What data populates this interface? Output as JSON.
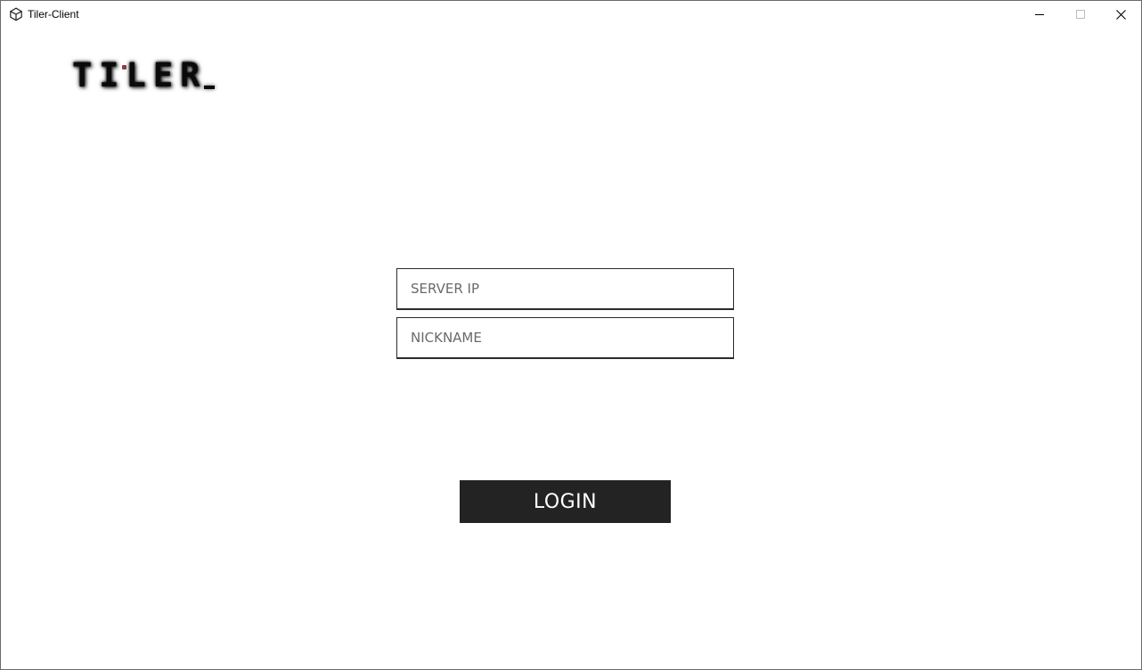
{
  "window": {
    "title": "Tiler-Client",
    "controls": {
      "minimize_icon": "minimize-icon",
      "maximize_icon": "maximize-icon",
      "close_icon": "close-icon"
    }
  },
  "logo": {
    "text": "TILER"
  },
  "form": {
    "server_ip": {
      "value": "",
      "placeholder": "SERVER IP"
    },
    "nickname": {
      "value": "",
      "placeholder": "NICKNAME"
    },
    "login_label": "LOGIN"
  },
  "colors": {
    "button_bg": "#232323",
    "button_text": "#ffffff",
    "field_border": "#2b2b2b",
    "logo_accent": "#7a1a2a"
  }
}
